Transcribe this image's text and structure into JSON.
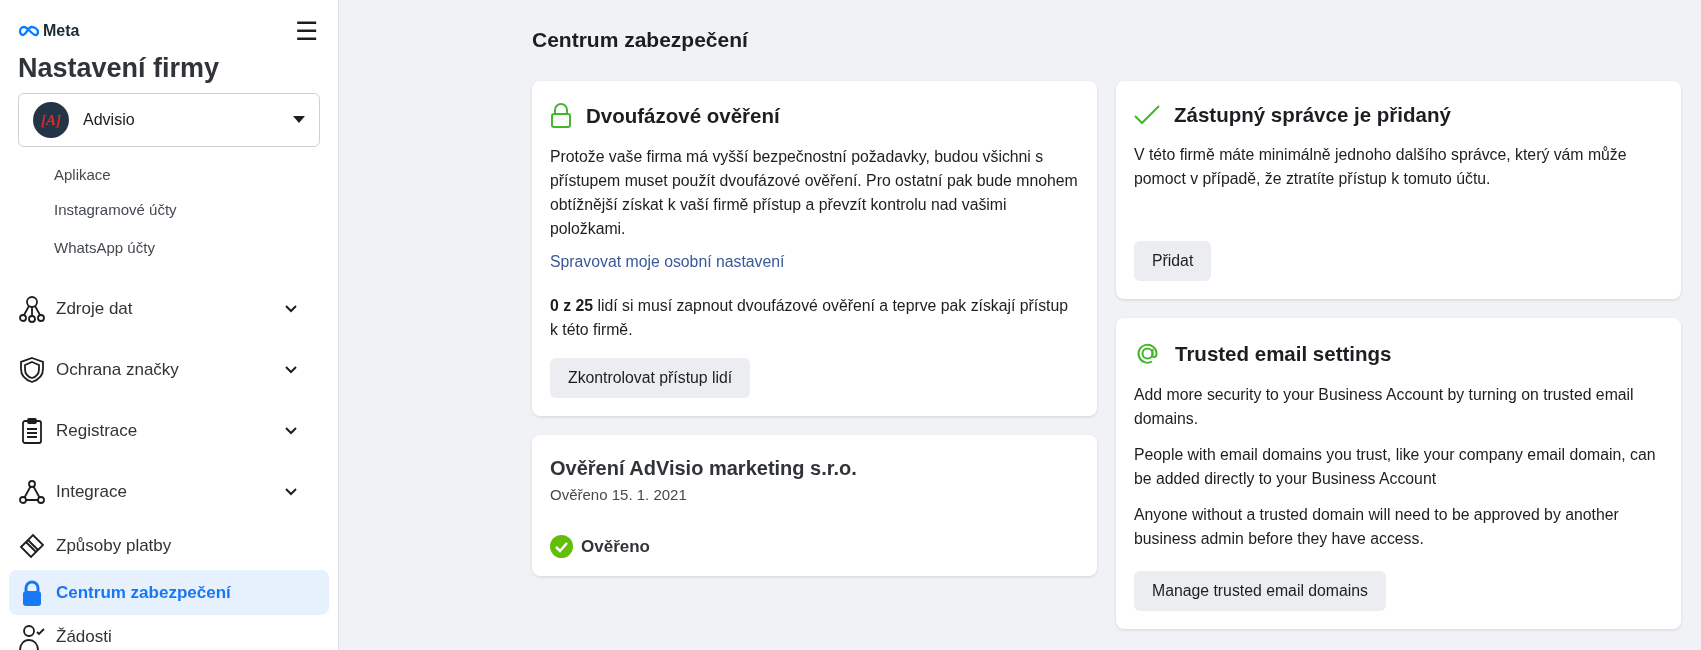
{
  "sidebar": {
    "logo": "Meta",
    "menu_icon": "☰",
    "title": "Nastavení firmy",
    "account": {
      "name": "Advisio",
      "avatar": "[A]"
    },
    "items": [
      {
        "kind": "sub",
        "label": "Aplikace",
        "selected": false
      },
      {
        "kind": "sub",
        "label": "Instagramové účty",
        "selected": false
      },
      {
        "kind": "sub",
        "label": "WhatsApp účty",
        "selected": false
      },
      {
        "kind": "group",
        "label": "Zdroje dat",
        "selected": false,
        "expanded": false
      },
      {
        "kind": "group",
        "label": "Ochrana značky",
        "selected": false,
        "expanded": false
      },
      {
        "kind": "group",
        "label": "Registrace",
        "selected": false,
        "expanded": false
      },
      {
        "kind": "group",
        "label": "Integrace",
        "selected": false,
        "expanded": false
      },
      {
        "kind": "link",
        "label": "Způsoby platby",
        "selected": false
      },
      {
        "kind": "link",
        "label": "Centrum zabezpečení",
        "selected": true
      },
      {
        "kind": "link",
        "label": "Žádosti",
        "selected": false
      }
    ]
  },
  "page_title": "Centrum zabezpečení",
  "columns": [
    [
      {
        "kind": "lock",
        "title": "Dvoufázové ověření",
        "paragraphs": [
          "Protože vaše firma má vyšší bezpečnostní požadavky, budou všichni s přístupem muset použít dvoufázové ověření. Pro ostatní pak bude mnohem obtížnější získat k vaší firmě přístup a převzít kontrolu nad vašimi položkami."
        ],
        "link": "Spravovat moje osobní nastavení",
        "note": "**0 z 25** lidí si musí zapnout dvoufázové ověření a teprve pak získají přístup k této firmě.",
        "button": "Zkontrolovat přístup lidí"
      },
      {
        "kind": "verification",
        "title": "Ověření AdVisio marketing s.r.o.",
        "subtitle": "Ověřeno 15. 1. 2021",
        "status": "Ověřeno"
      }
    ],
    [
      {
        "kind": "check",
        "title": "Zástupný správce je přidaný",
        "paragraphs": [
          "V této firmě máte minimálně jednoho dalšího správce, který vám může pomoct v případě, že ztratíte přístup k tomuto účtu."
        ],
        "button": "Přidat"
      },
      {
        "kind": "email",
        "title": "Trusted email settings",
        "paragraphs": [
          "Add more security to your Business Account by turning on trusted email domains.",
          "People with email domains you trust, like your company email domain, can be added directly to your Business Account",
          "Anyone without a trusted domain will need to be approved by another business admin before they have access."
        ],
        "button": "Manage trusted email domains"
      }
    ]
  ]
}
